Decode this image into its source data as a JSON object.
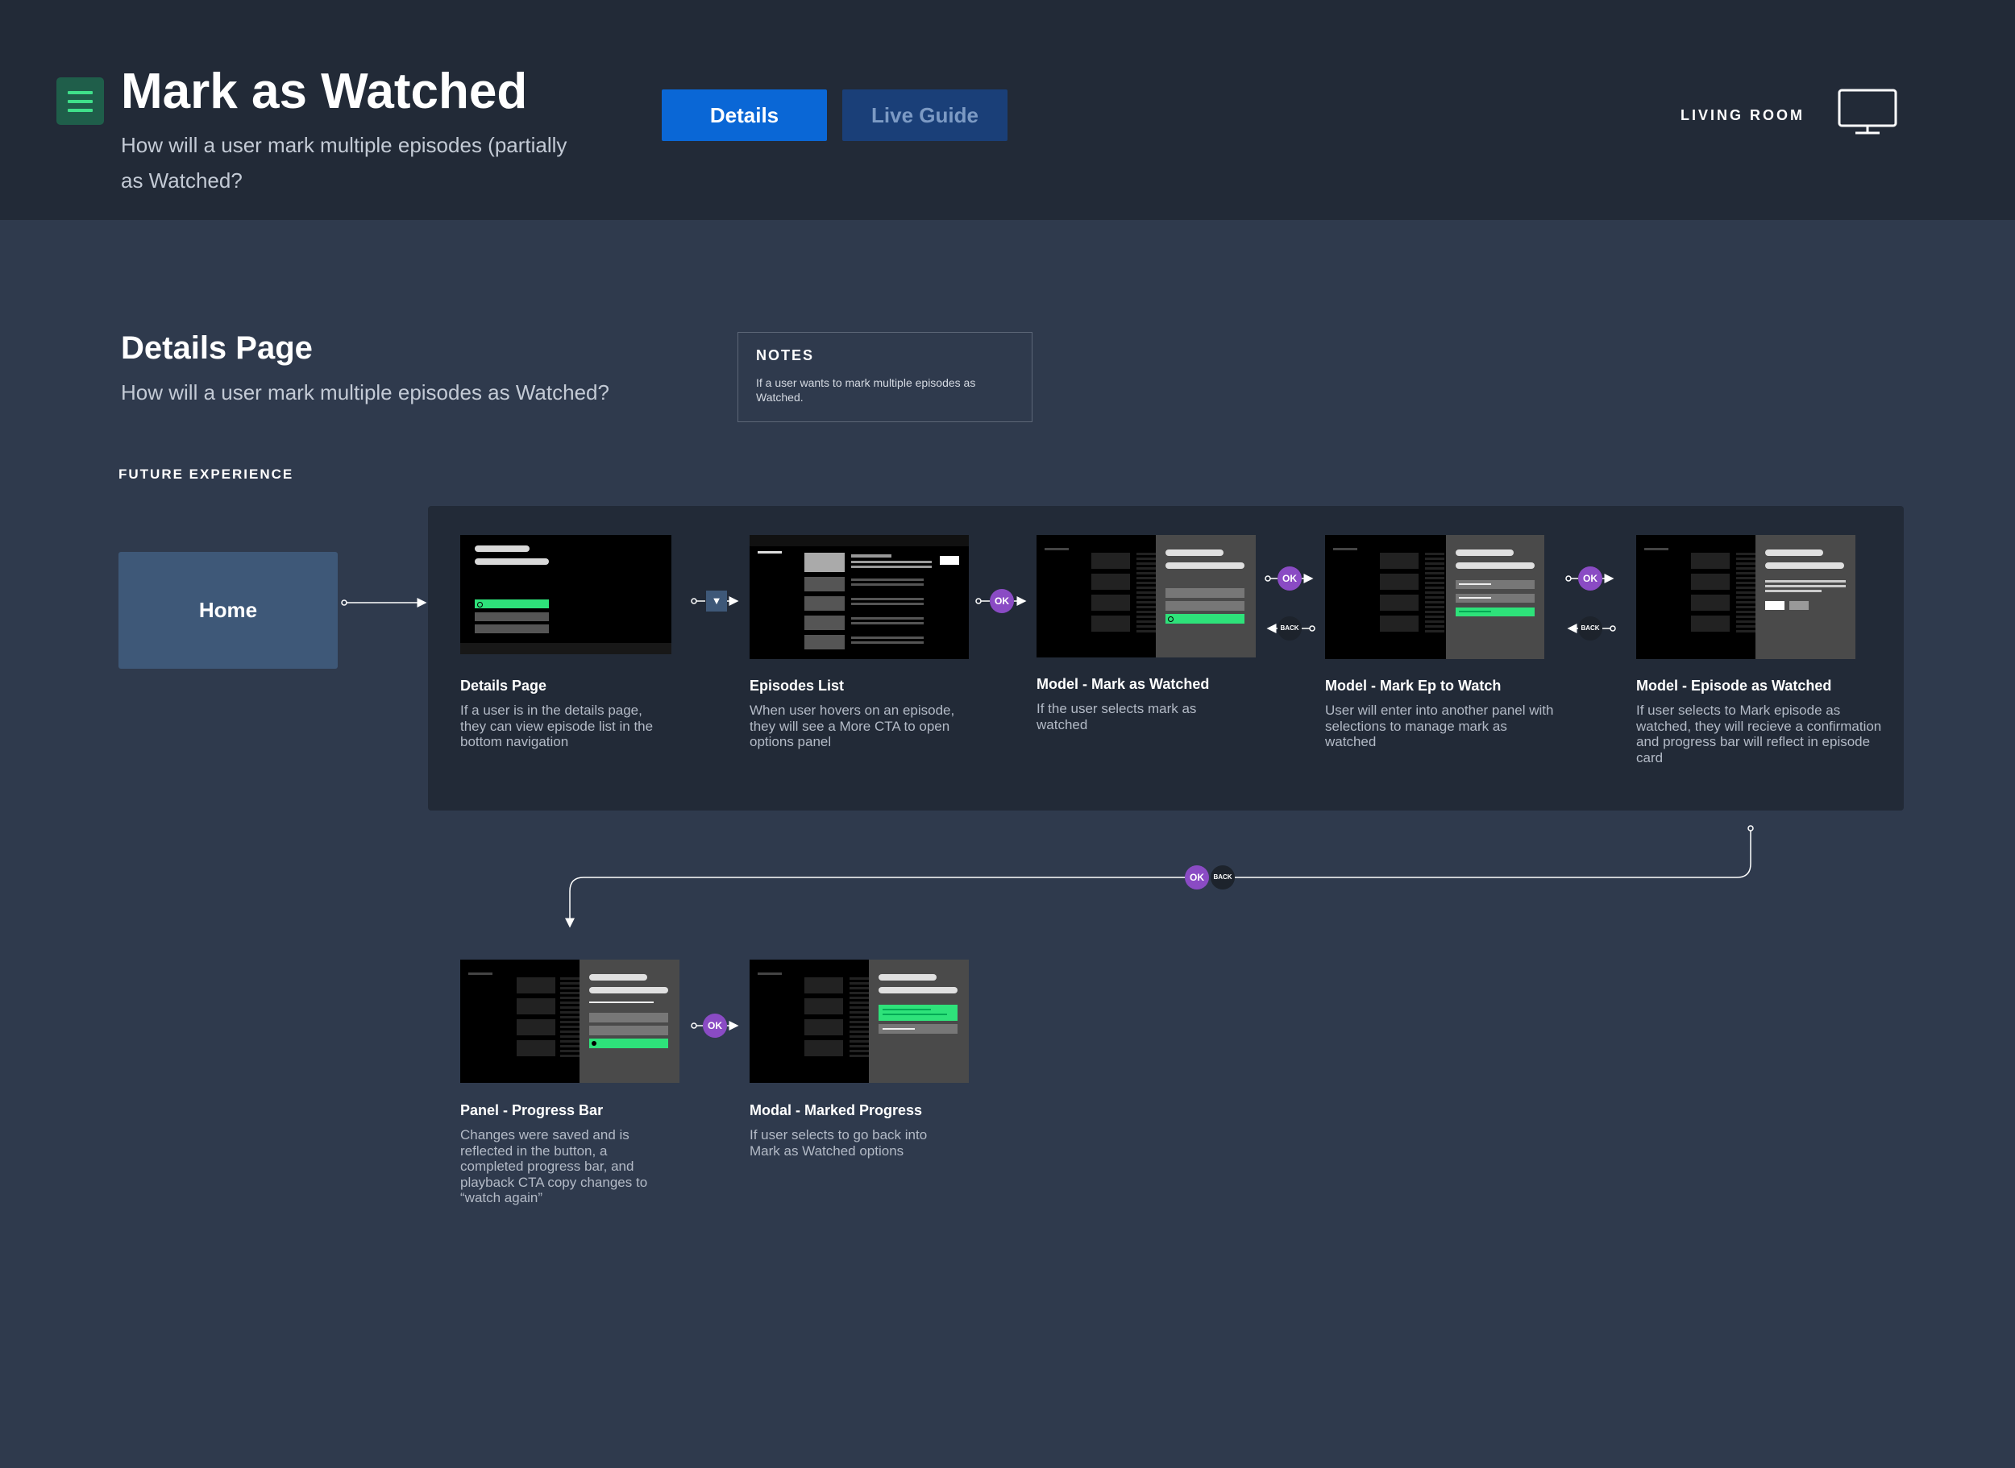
{
  "header": {
    "title": "Mark as Watched",
    "subtitle": "How will a user mark multiple episodes (partially as Watched?",
    "tabs": [
      {
        "label": "Details",
        "active": true
      },
      {
        "label": "Live Guide",
        "active": false
      }
    ],
    "room_label": "LIVING ROOM",
    "menu_icon": "hamburger-menu-icon",
    "device_icon": "tv-monitor-icon"
  },
  "section": {
    "title": "Details Page",
    "subtitle": "How will a user mark multiple episodes as Watched?"
  },
  "notes": {
    "title": "NOTES",
    "text": "If a user wants to mark multiple episodes as Watched."
  },
  "future_label": "FUTURE EXPERIENCE",
  "home_label": "Home",
  "badges": {
    "ok": "OK",
    "back": "BACK",
    "down": "▼"
  },
  "steps": [
    {
      "title": "Details Page",
      "desc": "If a user is in the details page, they can view episode list in the bottom navigation"
    },
    {
      "title": "Episodes List",
      "desc": "When user hovers on an episode, they will see a More CTA to open options panel"
    },
    {
      "title": "Model - Mark as Watched",
      "desc": "If the user selects mark as watched"
    },
    {
      "title": "Model - Mark Ep to Watch",
      "desc": "User will enter into another panel with selections to manage mark as watched"
    },
    {
      "title": "Model - Episode as Watched",
      "desc": "If user selects to Mark episode as watched, they will recieve a confirmation and progress bar will reflect in episode card"
    },
    {
      "title": "Panel - Progress Bar",
      "desc": "Changes were saved and is reflected in the button, a completed progress bar, and playback CTA copy changes to “watch again”"
    },
    {
      "title": "Modal - Marked Progress",
      "desc": "If user selects to go back into Mark as Watched options"
    }
  ],
  "colors": {
    "background": "#2f3a4d",
    "header": "#222a37",
    "accent_blue": "#0a67d6",
    "accent_green": "#2ee27a",
    "ok_purple": "#8a4bc4",
    "home_box": "#3e5878"
  }
}
